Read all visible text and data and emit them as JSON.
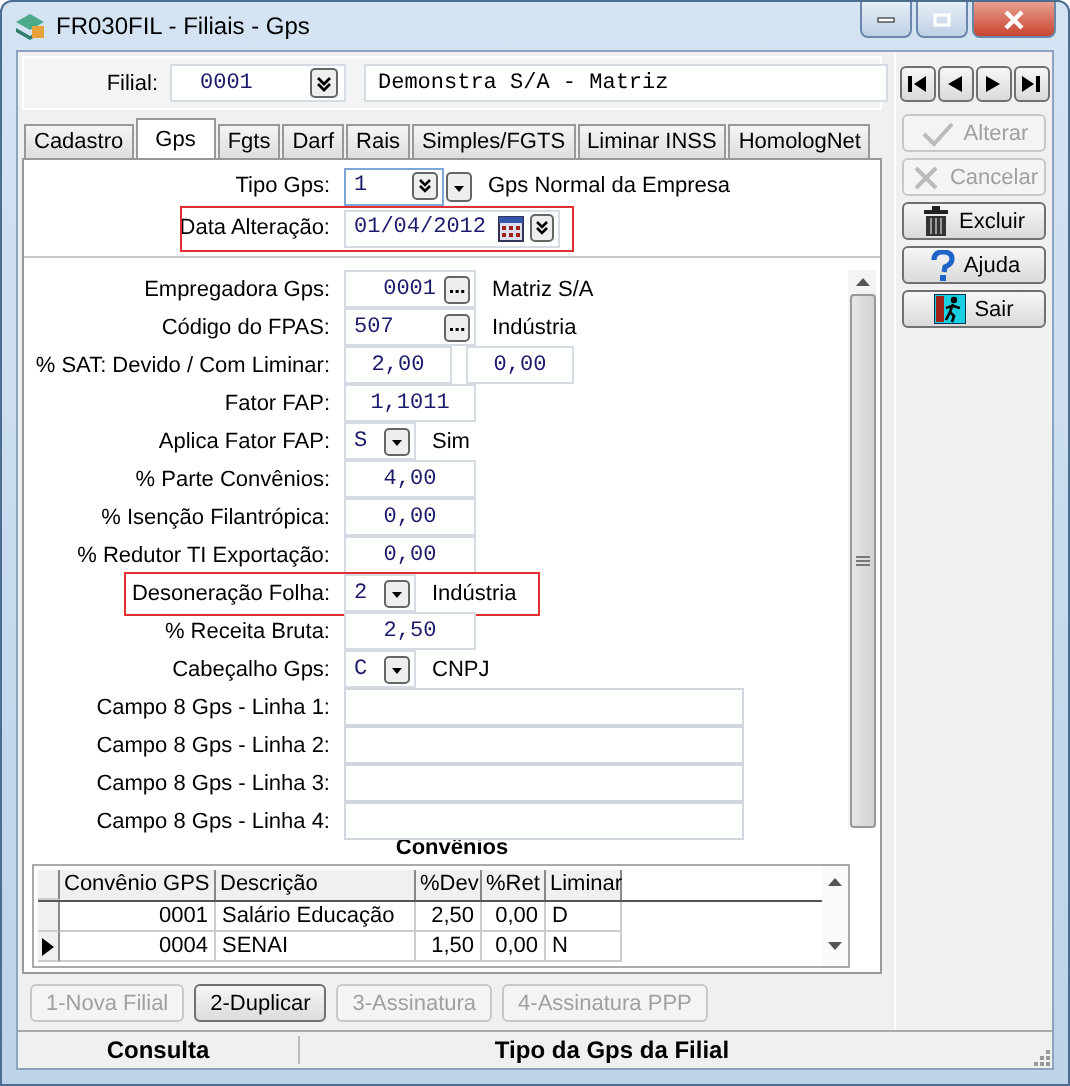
{
  "window": {
    "title": "FR030FIL - Filiais - Gps"
  },
  "filial": {
    "label": "Filial:",
    "code": "0001",
    "name": "Demonstra S/A - Matriz"
  },
  "tabs": [
    {
      "label": "Cadastro",
      "selected": false
    },
    {
      "label": "Gps",
      "selected": true
    },
    {
      "label": "Fgts",
      "selected": false
    },
    {
      "label": "Darf",
      "selected": false
    },
    {
      "label": "Rais",
      "selected": false
    },
    {
      "label": "Simples/FGTS",
      "selected": false
    },
    {
      "label": "Liminar INSS",
      "selected": false
    },
    {
      "label": "HomologNet",
      "selected": false
    }
  ],
  "header_fields": [
    {
      "kind": "combo",
      "label": "Tipo Gps:",
      "value": "1",
      "description": "Gps Normal da Empresa",
      "highlighted": false
    },
    {
      "kind": "date",
      "label": "Data Alteração:",
      "value": "01/04/2012",
      "highlighted": true
    }
  ],
  "fields": [
    {
      "kind": "lookup",
      "label": "Empregadora Gps:",
      "value": "0001",
      "description": "Matriz S/A",
      "highlighted": false
    },
    {
      "kind": "lookup",
      "label": "Código do FPAS:",
      "value": "507",
      "description": "Indústria",
      "highlighted": false
    },
    {
      "kind": "pair",
      "label": "% SAT: Devido / Com Liminar:",
      "values": [
        "2,00",
        "0,00"
      ],
      "highlighted": false
    },
    {
      "kind": "number",
      "label": "Fator FAP:",
      "value": "1,1011",
      "highlighted": false
    },
    {
      "kind": "combo",
      "label": "Aplica Fator FAP:",
      "value": "S",
      "description": "Sim",
      "highlighted": false
    },
    {
      "kind": "number",
      "label": "% Parte Convênios:",
      "value": "4,00",
      "highlighted": false
    },
    {
      "kind": "number",
      "label": "% Isenção Filantrópica:",
      "value": "0,00",
      "highlighted": false
    },
    {
      "kind": "number",
      "label": "% Redutor TI Exportação:",
      "value": "0,00",
      "highlighted": false
    },
    {
      "kind": "combo",
      "label": "Desoneração Folha:",
      "value": "2",
      "description": "Indústria",
      "highlighted": true
    },
    {
      "kind": "number",
      "label": "% Receita Bruta:",
      "value": "2,50",
      "highlighted": false
    },
    {
      "kind": "combo",
      "label": "Cabeçalho Gps:",
      "value": "C",
      "description": "CNPJ",
      "highlighted": false
    },
    {
      "kind": "text",
      "label": "Campo 8 Gps - Linha 1:",
      "highlighted": false
    },
    {
      "kind": "text",
      "label": "Campo 8 Gps - Linha 2:",
      "highlighted": false
    },
    {
      "kind": "text",
      "label": "Campo 8 Gps - Linha 3:",
      "highlighted": false
    },
    {
      "kind": "text",
      "label": "Campo 8 Gps - Linha 4:",
      "highlighted": false
    }
  ],
  "convenios": {
    "title": "Convênios",
    "columns": [
      "Convênio GPS",
      "Descrição",
      "%Dev",
      "%Ret",
      "Liminar"
    ],
    "rows": [
      {
        "cells": [
          "0001",
          "Salário Educação",
          "2,50",
          "0,00",
          "D"
        ],
        "selected": false
      },
      {
        "cells": [
          "0004",
          "SENAI",
          "1,50",
          "0,00",
          "N"
        ],
        "selected": true
      }
    ]
  },
  "actions": [
    {
      "kind": "edit",
      "label": "Alterar",
      "disabled": true
    },
    {
      "kind": "cancel",
      "label": "Cancelar",
      "disabled": true
    },
    {
      "kind": "delete",
      "label": "Excluir",
      "disabled": false
    },
    {
      "kind": "help",
      "label": "Ajuda",
      "disabled": false
    },
    {
      "kind": "exit",
      "label": "Sair",
      "disabled": false
    }
  ],
  "bottom_buttons": [
    {
      "label": "1-Nova Filial",
      "disabled": true
    },
    {
      "label": "2-Duplicar",
      "disabled": false
    },
    {
      "label": "3-Assinatura",
      "disabled": true
    },
    {
      "label": "4-Assinatura PPP",
      "disabled": true
    }
  ],
  "status_bar": [
    "Consulta",
    "Tipo da Gps da Filial"
  ]
}
